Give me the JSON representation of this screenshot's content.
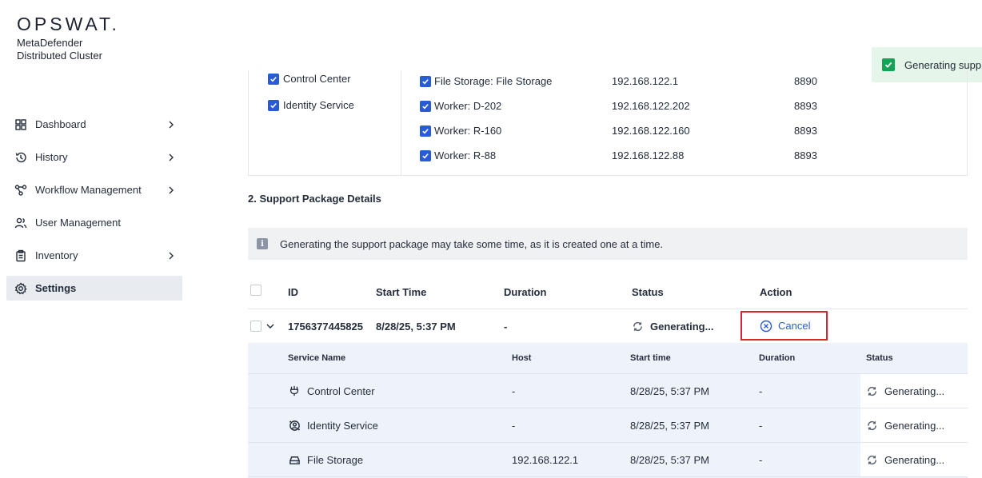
{
  "brand": {
    "logo": "OPSWAT.",
    "product_line1": "MetaDefender",
    "product_line2": "Distributed Cluster"
  },
  "nav": [
    {
      "label": "Dashboard",
      "icon": "grid-icon",
      "chevron": true
    },
    {
      "label": "History",
      "icon": "history-icon",
      "chevron": true
    },
    {
      "label": "Workflow Management",
      "icon": "workflow-icon",
      "chevron": true
    },
    {
      "label": "User Management",
      "icon": "users-icon",
      "chevron": false
    },
    {
      "label": "Inventory",
      "icon": "clipboard-icon",
      "chevron": true
    },
    {
      "label": "Settings",
      "icon": "gear-icon",
      "chevron": false,
      "active": true
    }
  ],
  "toast": {
    "text": "Generating supp",
    "color": "#15a355"
  },
  "selection": {
    "left": [
      "Control Center",
      "Identity Service"
    ],
    "rows": [
      {
        "service": "File Storage: File Storage",
        "host": "192.168.122.1",
        "port": "8890"
      },
      {
        "service": "Worker: D-202",
        "host": "192.168.122.202",
        "port": "8893"
      },
      {
        "service": "Worker: R-160",
        "host": "192.168.122.160",
        "port": "8893"
      },
      {
        "service": "Worker: R-88",
        "host": "192.168.122.88",
        "port": "8893"
      }
    ]
  },
  "section_title": "2. Support Package Details",
  "info_text": "Generating the support package may take some time, as it is created one at a time.",
  "table": {
    "headers": {
      "id": "ID",
      "start": "Start Time",
      "duration": "Duration",
      "status": "Status",
      "action": "Action"
    },
    "row": {
      "id": "1756377445825",
      "start": "8/28/25, 5:37 PM",
      "duration": "-",
      "status": "Generating...",
      "action": "Cancel"
    }
  },
  "sub_table": {
    "headers": {
      "service": "Service Name",
      "host": "Host",
      "start": "Start time",
      "duration": "Duration",
      "status": "Status"
    },
    "rows": [
      {
        "service": "Control Center",
        "icon": "plug-icon",
        "host": "-",
        "start": "8/28/25, 5:37 PM",
        "duration": "-",
        "status": "Generating..."
      },
      {
        "service": "Identity Service",
        "icon": "identity-icon",
        "host": "-",
        "start": "8/28/25, 5:37 PM",
        "duration": "-",
        "status": "Generating..."
      },
      {
        "service": "File Storage",
        "icon": "storage-icon",
        "host": "192.168.122.1",
        "start": "8/28/25, 5:37 PM",
        "duration": "-",
        "status": "Generating..."
      }
    ]
  },
  "colors": {
    "accent": "#2a5bd7",
    "highlight_border": "#d9262c",
    "sub_bg": "#eef2fb"
  }
}
